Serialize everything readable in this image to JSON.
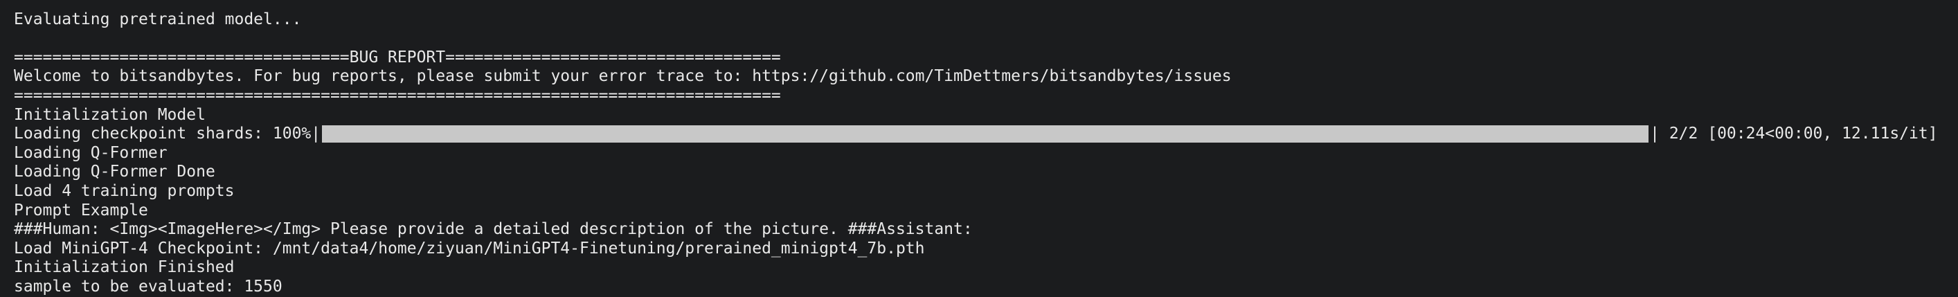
{
  "terminal": {
    "line_clipped": "                                                                ",
    "line_eval": "Evaluating pretrained model...",
    "line_blank": "",
    "bug_header": "===================================BUG REPORT===================================",
    "bug_welcome": "Welcome to bitsandbytes. For bug reports, please submit your error trace to: https://github.com/TimDettmers/bitsandbytes/issues",
    "bug_footer": "================================================================================",
    "init_model": "Initialization Model",
    "progress": {
      "label": "Loading checkpoint shards: 100%",
      "left_pipe": "|",
      "right_pipe": "|",
      "fraction": 1.0,
      "stats": " 2/2 [00:24<00:00, 12.11s/it]"
    },
    "loading_qformer": "Loading Q-Former",
    "loading_qformer_done": "Loading Q-Former Done",
    "load_prompts": "Load 4 training prompts",
    "prompt_example": "Prompt Example",
    "human_prompt": "###Human: <Img><ImageHere></Img> Please provide a detailed description of the picture. ###Assistant:",
    "load_checkpoint": "Load MiniGPT-4 Checkpoint: /mnt/data4/home/ziyuan/MiniGPT4-Finetuning/prerained_minigpt4_7b.pth",
    "init_finished": "Initialization Finished",
    "sample_count": "sample to be evaluated: 1550"
  },
  "colors": {
    "background": "#1b1c1e",
    "text": "#e9e9e9",
    "progress_fill": "#c8c8c8"
  }
}
